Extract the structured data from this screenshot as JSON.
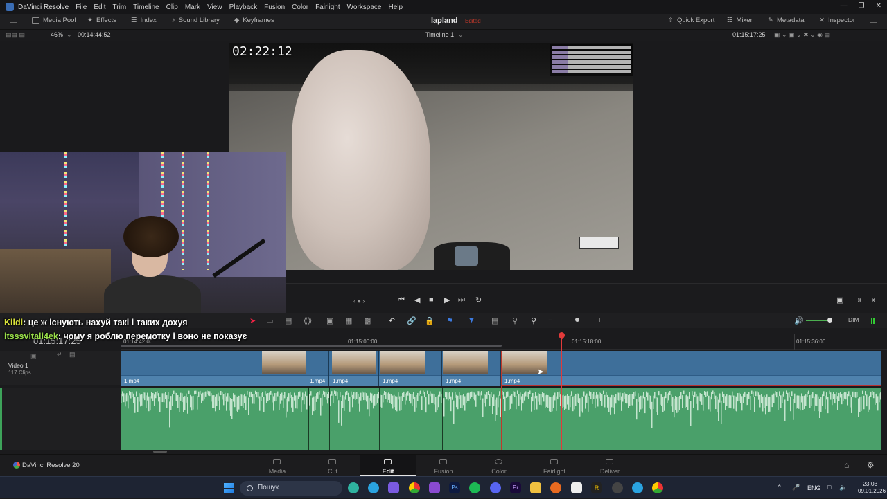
{
  "app": {
    "name": "DaVinci Resolve"
  },
  "menu": [
    "File",
    "Edit",
    "Trim",
    "Timeline",
    "Clip",
    "Mark",
    "View",
    "Playback",
    "Fusion",
    "Color",
    "Fairlight",
    "Workspace",
    "Help"
  ],
  "toolbar": {
    "media_pool": "Media Pool",
    "effects": "Effects",
    "index": "Index",
    "sound_library": "Sound Library",
    "keyframes": "Keyframes",
    "project_name": "lapland",
    "project_status": "Edited",
    "quick_export": "Quick Export",
    "mixer": "Mixer",
    "metadata": "Metadata",
    "inspector": "Inspector"
  },
  "viewer": {
    "zoom": "46%",
    "source_timecode": "00:14:44:52",
    "timeline_name": "Timeline 1",
    "record_timecode": "01:15:17:25",
    "video_overlay_timestamp": "02:22:12"
  },
  "timeline": {
    "current_timecode": "01:15:17:25",
    "ruler_labels": [
      "01:14:42:00",
      "01:15:00:00",
      "01:15:18:00",
      "01:15:36:00"
    ],
    "track_video_name": "Video 1",
    "track_video_clips": "117 Clips",
    "clips": [
      {
        "name": "1.mp4"
      },
      {
        "name": "1.mp4"
      },
      {
        "name": "1.mp4"
      },
      {
        "name": "1.mp4"
      },
      {
        "name": "1.mp4"
      },
      {
        "name": "1.mp4"
      }
    ],
    "audio_color": "#3a8a5a",
    "video_color": "#3e6f9a",
    "dim_label": "DIM"
  },
  "chat": [
    {
      "user": "Kildi",
      "message": "це ж існують нахуй такі і таких дохуя",
      "color": "#d8e23a"
    },
    {
      "user": "itsssvitali4ek",
      "message": "чому я роблю перемотку і воно не показує",
      "color": "#9be24a"
    }
  ],
  "pages": [
    "Media",
    "Cut",
    "Edit",
    "Fusion",
    "Color",
    "Fairlight",
    "Deliver"
  ],
  "active_page": "Edit",
  "brand": "DaVinci Resolve 20",
  "taskbar": {
    "search_placeholder": "Пошук",
    "language": "ENG",
    "time": "23:03",
    "date": "09.01.2026"
  }
}
